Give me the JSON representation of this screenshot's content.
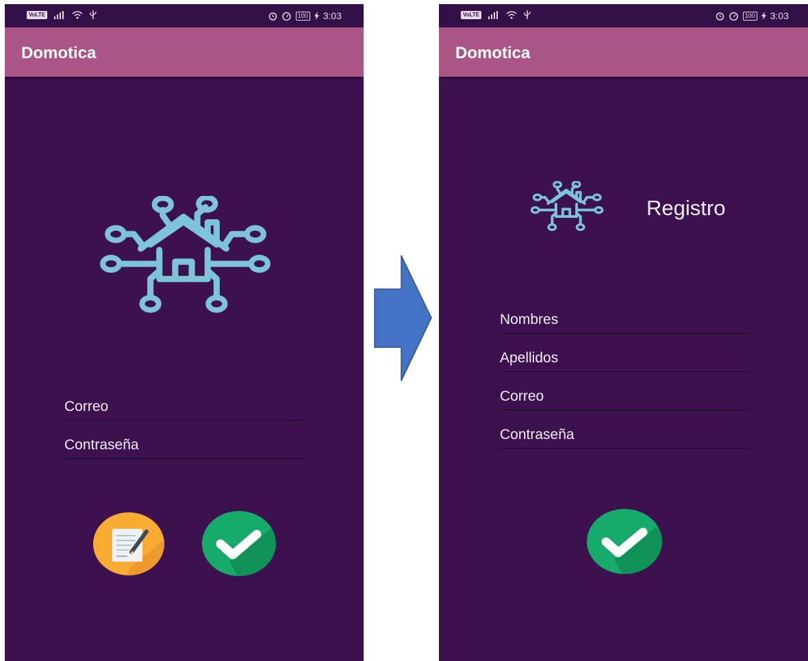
{
  "colors": {
    "background": "#3d1150",
    "status_bar": "#341048",
    "app_bar": "#ab5587",
    "icon": "#7ec4d8",
    "arrow": "#4472c4",
    "register_button": "#f9ac34",
    "confirm_button": "#16ab6a"
  },
  "login_screen": {
    "status_bar": {
      "network_badge": "VoLTE",
      "battery": "100",
      "time": "3:03"
    },
    "app_bar": {
      "title": "Domotica"
    },
    "logo_icon": "smart-home-circuit-icon",
    "fields": [
      {
        "placeholder": "Correo"
      },
      {
        "placeholder": "Contraseña"
      }
    ],
    "buttons": [
      {
        "icon": "edit-document-icon"
      },
      {
        "icon": "checkmark-icon"
      }
    ]
  },
  "transition_arrow": {
    "icon": "right-arrow-icon"
  },
  "register_screen": {
    "status_bar": {
      "network_badge": "VoLTE",
      "battery": "100",
      "time": "3:03"
    },
    "app_bar": {
      "title": "Domotica"
    },
    "logo_icon": "smart-home-circuit-icon",
    "heading": "Registro",
    "fields": [
      {
        "placeholder": "Nombres"
      },
      {
        "placeholder": "Apellidos"
      },
      {
        "placeholder": "Correo"
      },
      {
        "placeholder": "Contraseña"
      }
    ],
    "buttons": [
      {
        "icon": "checkmark-icon"
      }
    ]
  }
}
